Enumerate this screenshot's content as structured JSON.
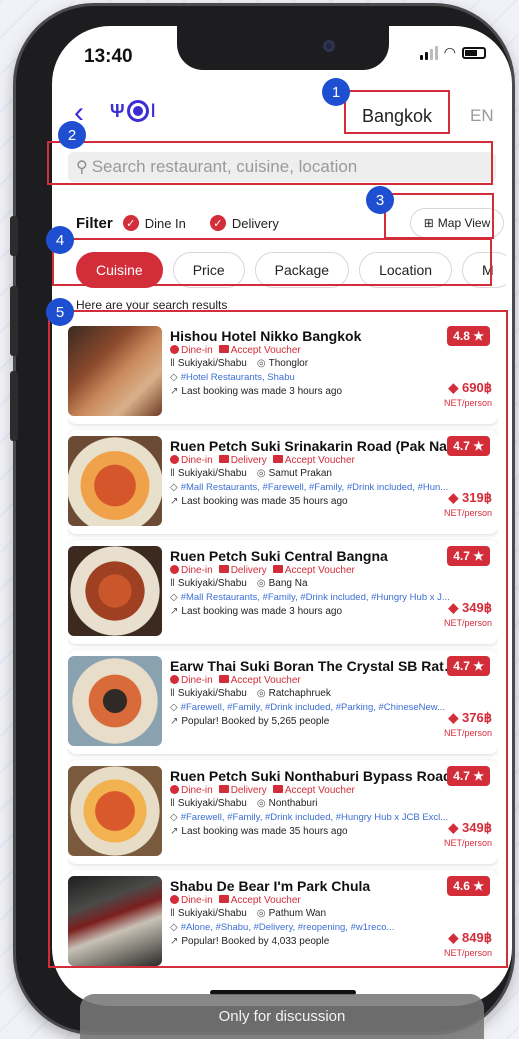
{
  "status_bar": {
    "time": "13:40"
  },
  "header": {
    "city": "Bangkok",
    "language": "EN"
  },
  "search": {
    "placeholder": "Search restaurant, cuisine, location"
  },
  "filter": {
    "label": "Filter",
    "options": [
      {
        "label": "Dine In",
        "checked": true
      },
      {
        "label": "Delivery",
        "checked": true
      }
    ],
    "map_view_label": "Map View"
  },
  "chips": [
    {
      "label": "Cuisine",
      "active": true
    },
    {
      "label": "Price",
      "active": false
    },
    {
      "label": "Package",
      "active": false
    },
    {
      "label": "Location",
      "active": false
    },
    {
      "label": "M",
      "active": false
    }
  ],
  "results_label": "Here are your search results",
  "restaurants": [
    {
      "name": "Hishou Hotel Nikko Bangkok",
      "tags": [
        "Dine-in",
        "Accept Voucher"
      ],
      "cuisine": "Sukiyaki/Shabu",
      "location": "Thonglor",
      "categories": "#Hotel Restaurants, Shabu",
      "booking": "Last booking was made 3 hours ago",
      "rating": "4.8",
      "price": "690฿",
      "price_unit": "NET/person"
    },
    {
      "name": "Ruen Petch Suki Srinakarin Road (Pak Nam)",
      "tags": [
        "Dine-in",
        "Delivery",
        "Accept Voucher"
      ],
      "cuisine": "Sukiyaki/Shabu",
      "location": "Samut Prakan",
      "categories": "#Mall Restaurants, #Farewell, #Family, #Drink included, #Hun...",
      "booking": "Last booking was made 35 hours ago",
      "rating": "4.7",
      "price": "319฿",
      "price_unit": "NET/person"
    },
    {
      "name": "Ruen Petch Suki Central Bangna",
      "tags": [
        "Dine-in",
        "Delivery",
        "Accept Voucher"
      ],
      "cuisine": "Sukiyaki/Shabu",
      "location": "Bang Na",
      "categories": "#Mall Restaurants, #Family, #Drink included, #Hungry Hub x J...",
      "booking": "Last booking was made 3 hours ago",
      "rating": "4.7",
      "price": "349฿",
      "price_unit": "NET/person"
    },
    {
      "name": "Earw Thai Suki Boran The Crystal SB Ratch...",
      "tags": [
        "Dine-in",
        "Accept Voucher"
      ],
      "cuisine": "Sukiyaki/Shabu",
      "location": "Ratchaphruek",
      "categories": "#Farewell, #Family, #Drink included, #Parking, #ChineseNew...",
      "booking": "Popular! Booked by 5,265 people",
      "rating": "4.7",
      "price": "376฿",
      "price_unit": "NET/person"
    },
    {
      "name": "Ruen Petch Suki Nonthaburi Bypass Road",
      "tags": [
        "Dine-in",
        "Delivery",
        "Accept Voucher"
      ],
      "cuisine": "Sukiyaki/Shabu",
      "location": "Nonthaburi",
      "categories": "#Farewell, #Family, #Drink included, #Hungry Hub x JCB Excl...",
      "booking": "Last booking was made 35 hours ago",
      "rating": "4.7",
      "price": "349฿",
      "price_unit": "NET/person"
    },
    {
      "name": "Shabu De Bear I'm Park Chula",
      "tags": [
        "Dine-in",
        "Accept Voucher"
      ],
      "cuisine": "Sukiyaki/Shabu",
      "location": "Pathum Wan",
      "categories": "#Alone, #Shabu, #Delivery, #reopening, #w1reco...",
      "booking": "Popular! Booked by 4,033 people",
      "rating": "4.6",
      "price": "849฿",
      "price_unit": "NET/person"
    }
  ],
  "annotations": [
    "1",
    "2",
    "3",
    "4",
    "5"
  ],
  "footer_note": "Only for discussion",
  "colors": {
    "accent": "#d32d3a",
    "brand": "#3d2dd4",
    "annotation": "#1f4fd1"
  }
}
